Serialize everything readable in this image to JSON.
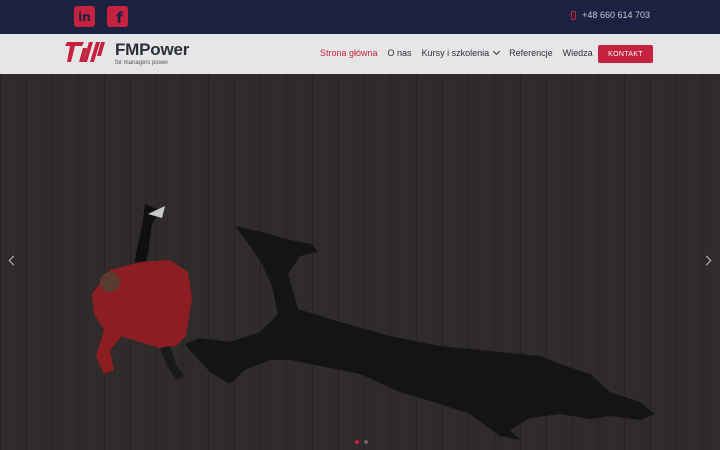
{
  "topbar": {
    "social": [
      {
        "name": "LinkedIn",
        "glyph": "in",
        "icon": "linkedin-icon"
      },
      {
        "name": "Facebook",
        "glyph": "f",
        "icon": "facebook-icon"
      }
    ],
    "phone": "+48 660 614 703",
    "phone_icon": "mobile-phone-icon"
  },
  "brand": {
    "name": "FMPower",
    "tagline": "for managers power",
    "accent": "#c5223f",
    "navy": "#1b2140"
  },
  "nav": {
    "items": [
      {
        "label": "Strona główna",
        "active": true
      },
      {
        "label": "O nas"
      },
      {
        "label": "Kursy i szkolenia",
        "dropdown": true
      },
      {
        "label": "Referencje"
      },
      {
        "label": "Wiedza"
      }
    ],
    "cta": "KONTAKT"
  },
  "hero": {
    "image": "person in red shirt jumping with long shadow on concrete floor",
    "arrows": [
      "chevron-left-icon",
      "chevron-right-icon"
    ],
    "slides": 2,
    "active_slide": 1
  }
}
